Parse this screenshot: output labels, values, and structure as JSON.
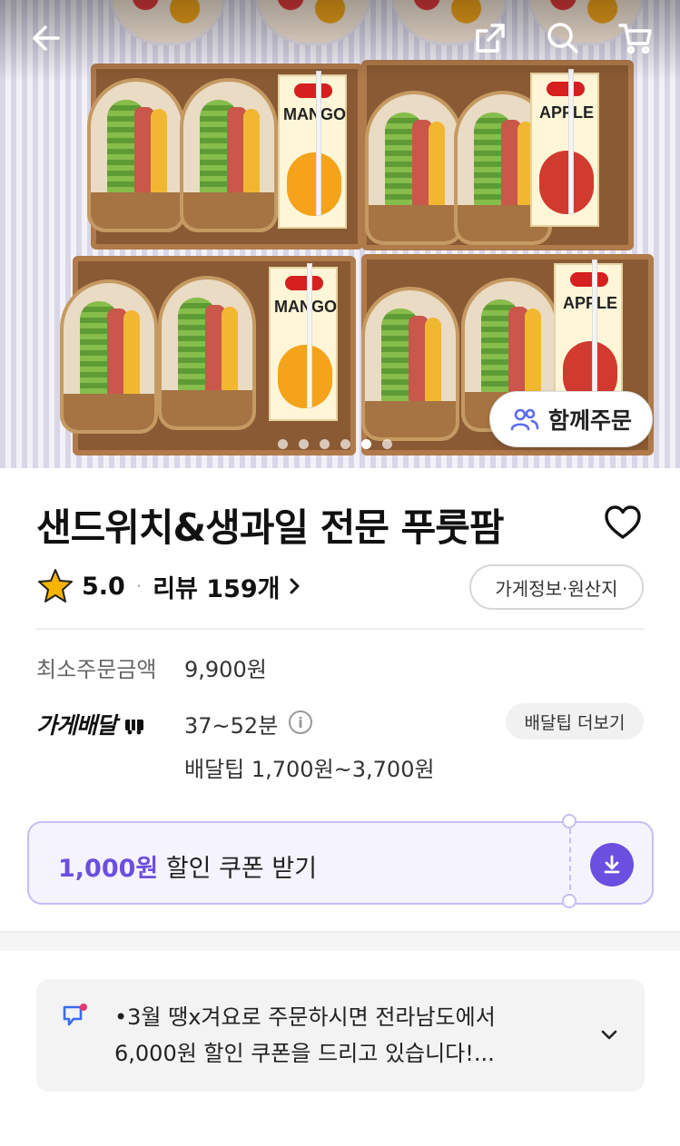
{
  "hero": {
    "juice_boxes": [
      "MANGO",
      "APPLE",
      "MANGO",
      "APPLE"
    ],
    "carousel": {
      "total": 6,
      "active_index": 4
    },
    "group_order_label": "함께주문"
  },
  "icons": {
    "back": "back-arrow-icon",
    "share": "share-icon",
    "search": "search-icon",
    "cart": "cart-icon",
    "favorite": "heart-icon",
    "rating": "star-icon",
    "group": "people-icon",
    "info": "info-icon",
    "download": "download-icon",
    "notice": "megaphone-icon",
    "expand": "chevron-down-icon"
  },
  "store": {
    "name": "샌드위치&생과일 전문 푸룻팜",
    "rating": "5.0",
    "review_label": "리뷰 159개",
    "info_origin_button": "가게정보·원산지"
  },
  "order_info": {
    "min_order_label": "최소주문금액",
    "min_order_value": "9,900원",
    "delivery_type": "가게배달",
    "delivery_time": "37~52분",
    "info_symbol": "i",
    "delivery_tip": "배달팁 1,700원~3,700원",
    "tip_more_button": "배달팁 더보기"
  },
  "coupon": {
    "amount": "1,000원",
    "label": " 할인 쿠폰 받기"
  },
  "notice": {
    "line1": "•3월 땡x겨요로 주문하시면 전라남도에서",
    "line2": "6,000원 할인 쿠폰을 드리고 있습니다!..."
  },
  "colors": {
    "accent": "#6b4fe0",
    "coupon_bg": "#f5f3fd",
    "star": "#f5b400"
  }
}
